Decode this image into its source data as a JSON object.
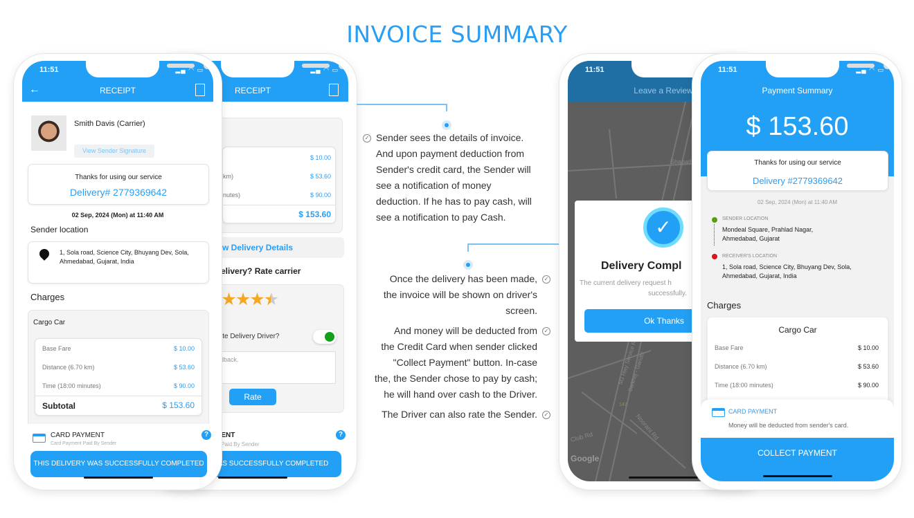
{
  "title": "INVOICE SUMMARY",
  "colors": {
    "accent": "#22a0f5",
    "title": "#2a9df4",
    "sender_dot": "#5a9e10",
    "receiver_dot": "#d11a1a",
    "toggle_on": "#11a11a",
    "star": "#f5a623"
  },
  "status_time": "11:51",
  "receipt_screen": {
    "header_title": "RECEIPT",
    "back_icon": "arrow-left-icon",
    "receipt_icon": "receipt-icon",
    "carrier_name": "Smith Davis (Carrier)",
    "signature_button": "View Sender Signature",
    "thanks": "Thanks for using our service",
    "delivery_no": "Delivery# 2779369642",
    "date": "02 Sep, 2024 (Mon) at 11:40 AM",
    "sender_location_label": "Sender location",
    "sender_address": "1, Sola road, Science City, Bhuyang Dev, Sola, Ahmedabad, Gujarat, India",
    "charges_label": "Charges",
    "vehicle": "Cargo Car",
    "charges": [
      {
        "label": "Base Fare",
        "value": "$ 10.00"
      },
      {
        "label": "Distance (6.70 km)",
        "value": "$ 53.60"
      },
      {
        "label": "Time (18:00 minutes)",
        "value": "$ 90.00"
      }
    ],
    "subtotal_label": "Subtotal",
    "subtotal": "$ 153.60",
    "payment_title": "CARD PAYMENT",
    "payment_sub": "Card Payment Paid By Sender",
    "completed_button": "THIS DELIVERY WAS SUCCESSFULLY COMPLETED"
  },
  "rating_screen": {
    "header_title": "RECEIPT",
    "charges": [
      {
        "label": "km)",
        "value": "$ 10.00"
      },
      {
        "label": "km)",
        "value": "$ 53.60"
      },
      {
        "label": "nutes)",
        "value": "$ 90.00"
      }
    ],
    "total": "$ 153.60",
    "details_link": "w Delivery Details",
    "rate_title": "elivery? Rate carrier",
    "rating": 4.5,
    "rating_max": 5,
    "favorite_label": "ite Delivery Driver?",
    "favorite_on": true,
    "feedback_placeholder": "dback.",
    "rate_button": "Rate",
    "payment_title": "MENT",
    "payment_sub": "Paid By Sender",
    "completed_button": "WAS SUCCESSFULLY COMPLETED"
  },
  "driver_screen": {
    "header_title": "Leave a Review",
    "dialog_title": "Delivery Compl",
    "dialog_text_1": "The current delivery request h",
    "dialog_text_2": "successfully.",
    "ok_button": "Ok Thanks",
    "map_labels": [
      "Club Rd",
      "Noorani Rd",
      "SG Hwy Service Rd",
      "Sarkhej - Gandhi",
      "147",
      "Shapath"
    ],
    "map_logo": "Google"
  },
  "summary_screen": {
    "header_title": "Payment Summary",
    "amount": "$ 153.60",
    "thanks": "Thanks for using our service",
    "delivery_no": "Delivery #2779369642",
    "date": "02 Sep, 2024 (Mon) at 11:40 AM",
    "sender_label": "SENDER LOCATION",
    "sender_address_1": "Mondeal Square, Prahlad Nagar,",
    "sender_address_2": "Ahmedabad, Gujarat",
    "receiver_label": "RECEIVER'S LOCATION",
    "receiver_address_1": "1, Sola road, Science City, Bhuyang Dev, Sola,",
    "receiver_address_2": "Ahmedabad, Gujarat, India",
    "charges_label": "Charges",
    "vehicle": "Cargo Car",
    "charges": [
      {
        "label": "Base Fare",
        "value": "$ 10.00"
      },
      {
        "label": "Distance (6.70 km)",
        "value": "$ 53.60"
      },
      {
        "label": "Time (18:00 minutes)",
        "value": "$ 90.00"
      }
    ],
    "payment_title": "CARD PAYMENT",
    "payment_text": "Money will be deducted from sender's card.",
    "collect_button": "COLLECT PAYMENT"
  },
  "notes_left": [
    "Sender sees the details of invoice.",
    "And upon payment deduction from",
    "Sender's credit card, the Sender will",
    "see a notification of money",
    "deduction. If he has to pay cash, will",
    "see a notification to pay Cash."
  ],
  "notes_right": [
    [
      "Once the delivery has been made,",
      "the invoice will be shown on driver's",
      "screen."
    ],
    [
      "And money will be deducted from",
      "the Credit Card when sender clicked",
      "\"Collect Payment\" button. In-case",
      "the, the Sender chose to pay by cash;",
      "he will hand over cash to the Driver."
    ],
    [
      "The Driver can also rate the Sender."
    ]
  ]
}
